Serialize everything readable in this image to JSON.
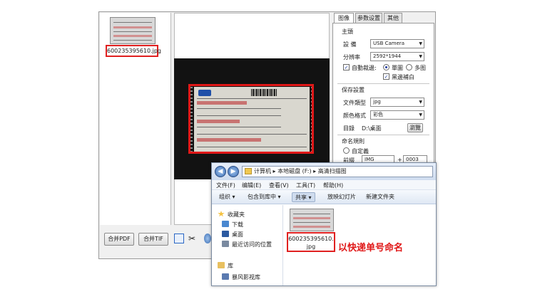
{
  "scanner": {
    "thumbnail_filename": "600235395610.jpg",
    "buttons": {
      "merge_pdf": "合并PDF",
      "merge_tif": "合并TIF"
    },
    "tabs": [
      "图像",
      "参数设置",
      "其他"
    ],
    "main_group": {
      "title": "主頭",
      "device_label": "設 備",
      "device_value": "USB Camera",
      "resolution_label": "分辨率",
      "resolution_value": "2592*1944",
      "auto_crop_label": "自動裁邊:",
      "single_radio": "單圖",
      "multi_radio": "多图",
      "deskew_label": "黑邊補白"
    },
    "save_group": {
      "title": "保存設置",
      "file_type_label": "文件類型",
      "file_type_value": "jpg",
      "color_mode_label": "颜色格式",
      "color_mode_value": "彩色",
      "dir_label": "目錄",
      "dir_value": "D:\\桌面",
      "browse_button": "瀏覽"
    },
    "naming_group": {
      "title": "命名規則",
      "custom_label": "自定義",
      "prefix_label": "前綴",
      "prefix_value": "IMG",
      "plus_sign": "+",
      "number_value": "0003"
    }
  },
  "explorer": {
    "breadcrumb": [
      "计算机",
      "本地磁盘 (F:)",
      "高清扫描图"
    ],
    "menus": [
      "文件(F)",
      "编辑(E)",
      "查看(V)",
      "工具(T)",
      "帮助(H)"
    ],
    "toolbar": [
      "组织 ▾",
      "包含到库中 ▾",
      "共享 ▾",
      "放映幻灯片",
      "新建文件夹"
    ],
    "nav": {
      "favorites": "收藏夹",
      "downloads": "下载",
      "desktop": "桌面",
      "recent": "最近访问的位置",
      "libraries": "库",
      "video_lib": "暴风影视库"
    },
    "file_name": "600235395610.jpg"
  },
  "annotation": "以快递单号命名",
  "colors": {
    "highlight": "#e01818"
  }
}
